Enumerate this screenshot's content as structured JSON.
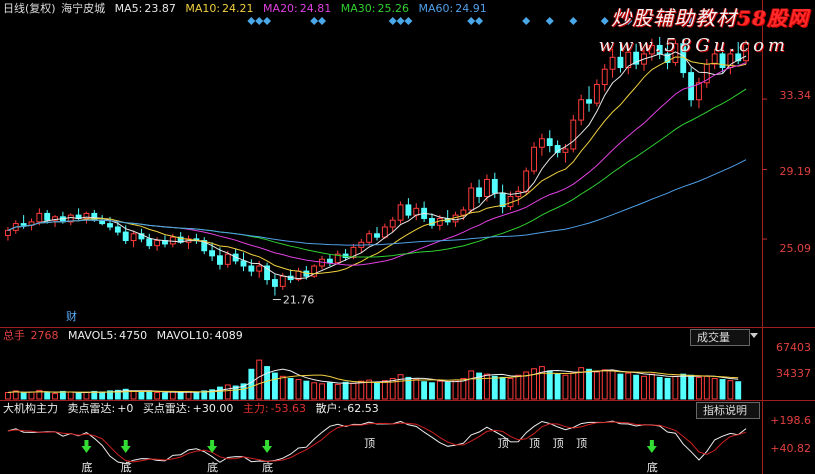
{
  "legend": {
    "period": "日线(复权)",
    "stock": "海宁皮城",
    "ma": [
      {
        "label": "MA5:",
        "value": "23.87",
        "color": "#e8e8e8"
      },
      {
        "label": "MA10:",
        "value": "24.21",
        "color": "#f0d040"
      },
      {
        "label": "MA20:",
        "value": "24.81",
        "color": "#e040e0"
      },
      {
        "label": "MA30:",
        "value": "25.26",
        "color": "#30d030"
      },
      {
        "label": "MA60:",
        "value": "24.91",
        "color": "#50a0e8"
      }
    ],
    "flag": "财"
  },
  "watermark": {
    "line1_a": "炒股辅助教材",
    "line1_b": "58股网",
    "line2": "www.58Gu.com"
  },
  "price_axis": [
    "33.34",
    "29.19",
    "25.09"
  ],
  "min_label": "21.76",
  "volume": {
    "title": "总手",
    "total": "2768",
    "mavol5_label": "MAVOL5:",
    "mavol5": "4750",
    "mavol10_label": "MAVOL10:",
    "mavol10": "4089",
    "button": "成交量",
    "axis": [
      "67403",
      "34337"
    ]
  },
  "indicator": {
    "name": "大机构主力",
    "sell_label": "卖点雷达:",
    "sell": "+0",
    "buy_label": "买点雷达:",
    "buy": "+30.00",
    "main_label": "主力:",
    "main": "-53.63",
    "retail_label": "散户:",
    "retail": "-62.53",
    "button": "指标说明",
    "axis": [
      "+198.6",
      "+40.82"
    ],
    "top_word": "顶",
    "bottom_word": "底"
  },
  "chart_data": {
    "type": "candlestick",
    "title": "海宁皮城 日线(复权)",
    "ylim": [
      20.2,
      38.0
    ],
    "min_point": {
      "index": 34,
      "value": 21.76
    },
    "candles": [
      [
        25.3,
        25.8,
        25.0,
        25.6
      ],
      [
        25.6,
        26.2,
        25.4,
        26.0
      ],
      [
        26.0,
        26.5,
        25.7,
        25.9
      ],
      [
        25.9,
        26.3,
        25.6,
        26.1
      ],
      [
        26.1,
        26.9,
        25.9,
        26.6
      ],
      [
        26.6,
        26.8,
        26.0,
        26.2
      ],
      [
        26.2,
        26.5,
        25.8,
        26.4
      ],
      [
        26.4,
        26.7,
        26.0,
        26.1
      ],
      [
        26.1,
        26.6,
        25.9,
        26.5
      ],
      [
        26.5,
        26.9,
        26.2,
        26.3
      ],
      [
        26.3,
        26.7,
        26.0,
        26.6
      ],
      [
        26.6,
        26.8,
        26.1,
        26.2
      ],
      [
        26.2,
        26.5,
        25.9,
        26.0
      ],
      [
        26.0,
        26.4,
        25.6,
        25.8
      ],
      [
        25.8,
        26.1,
        25.3,
        25.5
      ],
      [
        25.5,
        25.9,
        24.8,
        25.0
      ],
      [
        25.0,
        25.6,
        24.6,
        25.4
      ],
      [
        25.4,
        25.7,
        24.9,
        25.1
      ],
      [
        25.1,
        25.4,
        24.5,
        24.7
      ],
      [
        24.7,
        25.2,
        24.4,
        25.0
      ],
      [
        25.0,
        25.3,
        24.6,
        24.8
      ],
      [
        24.8,
        25.4,
        24.6,
        25.2
      ],
      [
        25.2,
        25.5,
        24.8,
        24.9
      ],
      [
        24.9,
        25.3,
        24.5,
        25.1
      ],
      [
        25.1,
        25.4,
        24.8,
        25.0
      ],
      [
        25.0,
        25.2,
        24.2,
        24.4
      ],
      [
        24.4,
        24.9,
        23.8,
        24.1
      ],
      [
        24.1,
        24.6,
        23.3,
        23.6
      ],
      [
        23.6,
        24.4,
        23.4,
        24.2
      ],
      [
        24.2,
        24.5,
        23.6,
        23.8
      ],
      [
        23.8,
        24.3,
        23.2,
        23.5
      ],
      [
        23.5,
        23.9,
        22.9,
        23.2
      ],
      [
        23.2,
        23.8,
        22.8,
        23.5
      ],
      [
        23.5,
        23.7,
        22.4,
        22.7
      ],
      [
        22.7,
        23.0,
        21.76,
        22.3
      ],
      [
        22.3,
        23.1,
        22.1,
        22.9
      ],
      [
        22.9,
        23.3,
        22.5,
        22.7
      ],
      [
        22.7,
        23.4,
        22.6,
        23.2
      ],
      [
        23.2,
        23.5,
        22.7,
        22.9
      ],
      [
        22.9,
        23.6,
        22.8,
        23.5
      ],
      [
        23.5,
        24.1,
        23.3,
        23.9
      ],
      [
        23.9,
        24.2,
        23.5,
        23.7
      ],
      [
        23.7,
        24.4,
        23.6,
        24.2
      ],
      [
        24.2,
        24.5,
        23.8,
        24.0
      ],
      [
        24.0,
        24.8,
        23.9,
        24.6
      ],
      [
        24.6,
        25.1,
        24.3,
        24.9
      ],
      [
        24.9,
        25.6,
        24.7,
        25.4
      ],
      [
        25.4,
        25.8,
        25.0,
        25.2
      ],
      [
        25.2,
        26.0,
        25.1,
        25.8
      ],
      [
        25.8,
        26.4,
        25.5,
        26.2
      ],
      [
        26.2,
        27.3,
        26.0,
        27.1
      ],
      [
        27.1,
        27.5,
        26.3,
        26.5
      ],
      [
        26.5,
        27.2,
        26.2,
        26.9
      ],
      [
        26.9,
        27.3,
        26.1,
        26.3
      ],
      [
        26.3,
        26.6,
        25.7,
        25.9
      ],
      [
        25.9,
        26.5,
        25.6,
        26.3
      ],
      [
        26.3,
        26.8,
        25.9,
        26.1
      ],
      [
        26.1,
        26.7,
        25.8,
        26.5
      ],
      [
        26.5,
        27.0,
        26.2,
        26.8
      ],
      [
        26.8,
        28.4,
        26.6,
        28.1
      ],
      [
        28.1,
        28.6,
        27.2,
        27.6
      ],
      [
        27.6,
        28.9,
        27.3,
        28.6
      ],
      [
        28.6,
        29.0,
        27.5,
        27.8
      ],
      [
        27.8,
        28.3,
        26.6,
        27.0
      ],
      [
        27.0,
        27.9,
        26.8,
        27.6
      ],
      [
        27.6,
        28.2,
        27.1,
        27.9
      ],
      [
        27.9,
        29.3,
        27.7,
        29.1
      ],
      [
        29.1,
        30.8,
        28.9,
        30.5
      ],
      [
        30.5,
        31.3,
        30.0,
        31.0
      ],
      [
        31.0,
        31.5,
        30.2,
        30.6
      ],
      [
        30.6,
        30.9,
        29.9,
        30.2
      ],
      [
        30.2,
        30.7,
        29.6,
        30.4
      ],
      [
        30.4,
        32.4,
        30.2,
        32.1
      ],
      [
        32.1,
        33.6,
        31.8,
        33.3
      ],
      [
        33.3,
        34.1,
        32.6,
        33.1
      ],
      [
        33.1,
        34.5,
        32.9,
        34.2
      ],
      [
        34.2,
        35.4,
        33.8,
        35.1
      ],
      [
        35.1,
        36.3,
        34.6,
        35.8
      ],
      [
        35.8,
        36.6,
        34.9,
        35.2
      ],
      [
        35.2,
        36.4,
        34.8,
        36.1
      ],
      [
        36.1,
        36.6,
        35.1,
        35.4
      ],
      [
        35.4,
        36.3,
        35.0,
        36.0
      ],
      [
        36.0,
        36.9,
        35.6,
        36.5
      ],
      [
        36.5,
        37.0,
        35.7,
        36.0
      ],
      [
        36.0,
        36.6,
        35.1,
        35.5
      ],
      [
        35.5,
        36.8,
        35.3,
        36.6
      ],
      [
        36.6,
        36.9,
        34.6,
        34.9
      ],
      [
        34.9,
        35.2,
        32.9,
        33.3
      ],
      [
        33.3,
        34.6,
        32.8,
        34.3
      ],
      [
        34.3,
        35.7,
        34.0,
        35.4
      ],
      [
        35.4,
        36.3,
        35.1,
        36.0
      ],
      [
        36.0,
        36.5,
        34.9,
        35.2
      ],
      [
        35.2,
        36.3,
        34.8,
        36.0
      ],
      [
        36.0,
        36.7,
        35.4,
        35.6
      ],
      [
        35.6,
        36.8,
        35.4,
        36.6
      ]
    ],
    "volumes": [
      12,
      15,
      11,
      13,
      16,
      12,
      10,
      14,
      13,
      11,
      12,
      14,
      13,
      15,
      16,
      18,
      14,
      13,
      15,
      12,
      11,
      13,
      12,
      14,
      13,
      15,
      17,
      22,
      26,
      24,
      28,
      55,
      72,
      60,
      48,
      42,
      38,
      36,
      33,
      30,
      28,
      30,
      27,
      31,
      29,
      33,
      35,
      30,
      34,
      38,
      45,
      40,
      36,
      32,
      30,
      33,
      31,
      35,
      38,
      52,
      48,
      46,
      42,
      40,
      38,
      44,
      50,
      56,
      60,
      52,
      46,
      44,
      48,
      58,
      55,
      50,
      54,
      52,
      46,
      48,
      44,
      42,
      46,
      40,
      38,
      42,
      46,
      44,
      40,
      42,
      38,
      36,
      34,
      32
    ],
    "vol_max": 67403
  }
}
